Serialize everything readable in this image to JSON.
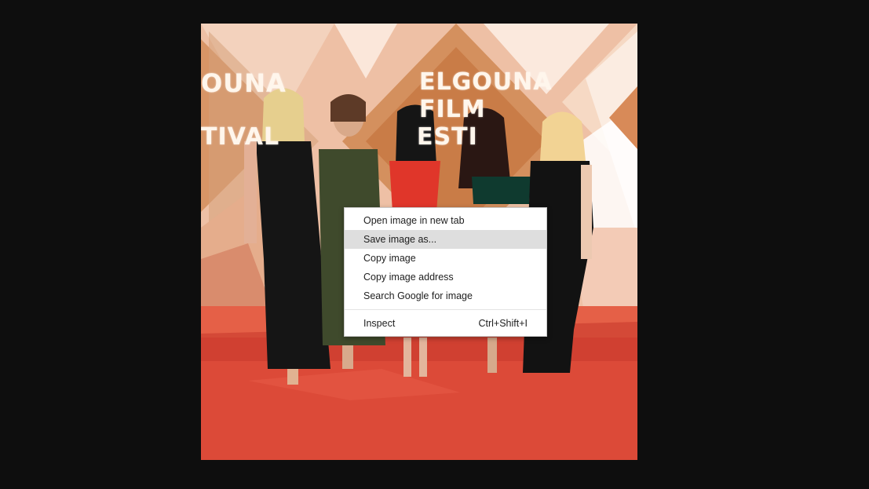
{
  "background_color": "#0e0e0e",
  "photo": {
    "description_icon": "event-photo",
    "sign": {
      "left_lines": [
        "OUNA",
        "",
        "TIVAL"
      ],
      "center_lines": [
        "ELGOUNA",
        "FILM",
        "ESTI"
      ]
    }
  },
  "context_menu": {
    "items": [
      {
        "label": "Open image in new tab",
        "shortcut": ""
      },
      {
        "label": "Save image as...",
        "shortcut": "",
        "highlighted": true
      },
      {
        "label": "Copy image",
        "shortcut": ""
      },
      {
        "label": "Copy image address",
        "shortcut": ""
      },
      {
        "label": "Search Google for image",
        "shortcut": ""
      }
    ],
    "footer_items": [
      {
        "label": "Inspect",
        "shortcut": "Ctrl+Shift+I"
      }
    ],
    "highlight_color": "#dedede"
  }
}
